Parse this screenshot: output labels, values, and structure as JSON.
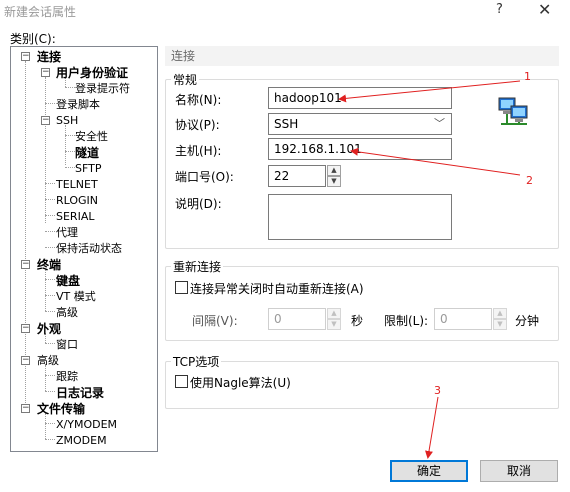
{
  "window": {
    "title": "新建会话属性",
    "help_glyph": "?",
    "close_glyph": "✕"
  },
  "category_label": "类别(C):",
  "tree": {
    "connection": "连接",
    "user_auth": "用户身份验证",
    "login_prompt": "登录提示符",
    "login_script": "登录脚本",
    "ssh": "SSH",
    "security": "安全性",
    "tunnel": "隧道",
    "sftp": "SFTP",
    "telnet": "TELNET",
    "rlogin": "RLOGIN",
    "serial": "SERIAL",
    "proxy": "代理",
    "keepalive": "保持活动状态",
    "terminal": "终端",
    "keyboard": "键盘",
    "vt_mode": "VT 模式",
    "advanced1": "高级",
    "appearance": "外观",
    "window": "窗口",
    "advanced2": "高级",
    "trace": "跟踪",
    "logging": "日志记录",
    "file_transfer": "文件传输",
    "xymodem": "X/YMODEM",
    "zmodem": "ZMODEM"
  },
  "section_title": "连接",
  "general": {
    "title": "常规",
    "name_label": "名称(N):",
    "name_value": "hadoop101",
    "protocol_label": "协议(P):",
    "protocol_value": "SSH",
    "host_label": "主机(H):",
    "host_value": "192.168.1.101",
    "port_label": "端口号(O):",
    "port_value": "22",
    "desc_label": "说明(D):",
    "desc_value": ""
  },
  "reconnect": {
    "title": "重新连接",
    "checkbox_label": "连接异常关闭时自动重新连接(A)",
    "interval_label": "间隔(V):",
    "interval_value": "0",
    "interval_unit": "秒",
    "limit_label": "限制(L):",
    "limit_value": "0",
    "limit_unit": "分钟"
  },
  "tcp": {
    "title": "TCP选项",
    "nagle_label": "使用Nagle算法(U)"
  },
  "buttons": {
    "ok": "确定",
    "cancel": "取消"
  },
  "annotations": {
    "n1": "1",
    "n2": "2",
    "n3": "3"
  },
  "colors": {
    "annotation": "#e02020",
    "default_button_border": "#0078d7"
  }
}
